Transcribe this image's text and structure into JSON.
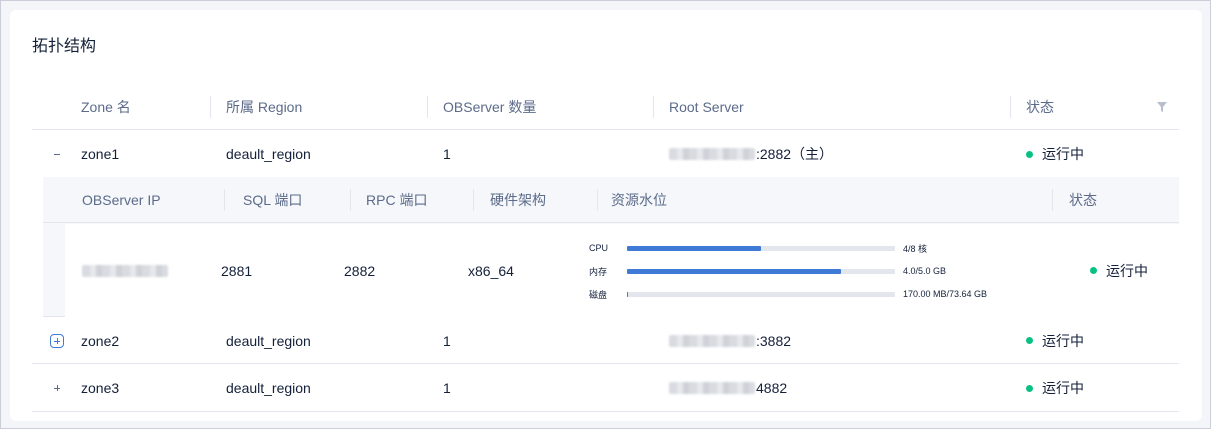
{
  "card": {
    "title": "拓扑结构"
  },
  "columns": {
    "zone": "Zone 名",
    "region": "所属 Region",
    "observer_count": "OBServer 数量",
    "root_server": "Root Server",
    "status": "状态"
  },
  "zones": [
    {
      "name": "zone1",
      "region": "deault_region",
      "count": "1",
      "root_suffix": ":2882（主）",
      "status": "运行中",
      "expanded": true
    },
    {
      "name": "zone2",
      "region": "deault_region",
      "count": "1",
      "root_suffix": ":3882",
      "status": "运行中",
      "expanded": false
    },
    {
      "name": "zone3",
      "region": "deault_region",
      "count": "1",
      "root_suffix": "4882",
      "status": "运行中",
      "expanded": false
    }
  ],
  "sub_columns": {
    "ip": "OBServer IP",
    "sql_port": "SQL 端口",
    "rpc_port": "RPC 端口",
    "arch": "硬件架构",
    "resources": "资源水位",
    "status": "状态"
  },
  "observer": {
    "sql_port": "2881",
    "rpc_port": "2882",
    "arch": "x86_64",
    "status": "运行中",
    "resources": [
      {
        "label": "CPU",
        "value": "4/8 核",
        "ratio": 0.5
      },
      {
        "label": "内存",
        "value": "4.0/5.0 GB",
        "ratio": 0.8
      },
      {
        "label": "磁盘",
        "value": "170.00 MB/73.64 GB",
        "ratio": 0.0023
      }
    ]
  },
  "colors": {
    "accent": "#3f7ad6",
    "running": "#0ac185",
    "border": "#e3e6ec"
  },
  "icons": {
    "filter": "filter-icon",
    "collapse": "minus-icon",
    "expand": "plus-icon"
  }
}
